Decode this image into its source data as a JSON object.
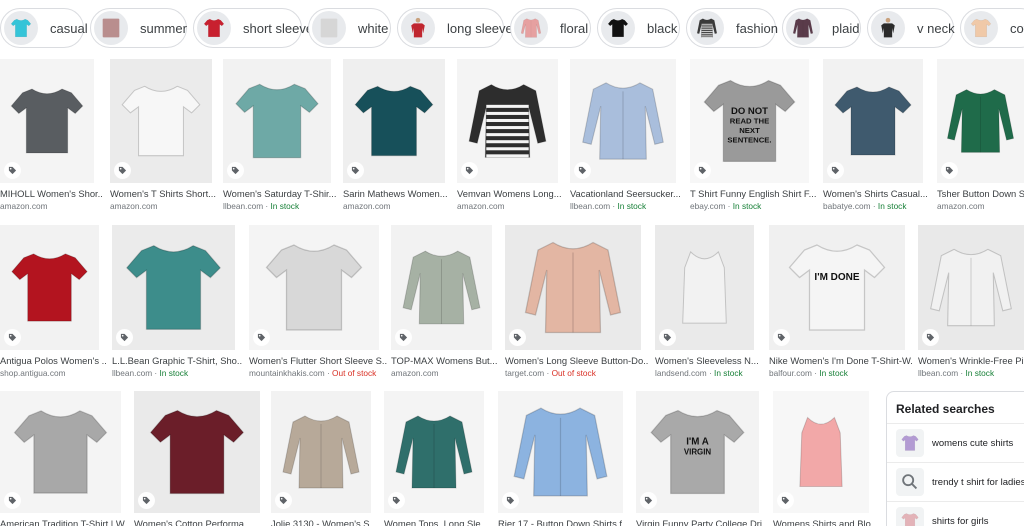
{
  "chips": [
    {
      "label": "casual",
      "color": "#35c4d8",
      "style": "tee"
    },
    {
      "label": "summer",
      "color": "#b98e8e",
      "style": "photo"
    },
    {
      "label": "short sleeve",
      "color": "#c8202f",
      "style": "tee"
    },
    {
      "label": "white",
      "color": "#d6d6d6",
      "style": "photo"
    },
    {
      "label": "long sleeve",
      "color": "#c0262f",
      "style": "person"
    },
    {
      "label": "floral",
      "color": "#e6a0a0",
      "style": "long"
    },
    {
      "label": "black",
      "color": "#111111",
      "style": "tee"
    },
    {
      "label": "fashion",
      "color": "#3a3a3a",
      "style": "stripe"
    },
    {
      "label": "plaid",
      "color": "#5a3b4a",
      "style": "long"
    },
    {
      "label": "v neck",
      "color": "#2b2b2b",
      "style": "person"
    },
    {
      "label": "cotto",
      "color": "#f0c9a8",
      "style": "tee"
    }
  ],
  "results": [
    [
      {
        "title": "MIHOLL Women's Shor...",
        "source": "amazon.com",
        "stock": "",
        "color": "#595d61",
        "bg": "#f4f4f4",
        "style": "tee"
      },
      {
        "title": "Women's T Shirts Short...",
        "source": "amazon.com",
        "stock": "",
        "color": "#f7f7f7",
        "bg": "#ebebeb",
        "style": "tee"
      },
      {
        "title": "Women's Saturday T-Shir...",
        "source": "llbean.com",
        "stock": "In stock",
        "color": "#6ea9a6",
        "bg": "#f2f2f2",
        "style": "tee"
      },
      {
        "title": "Sarin Mathews Women...",
        "source": "amazon.com",
        "stock": "",
        "color": "#17505a",
        "bg": "#efefef",
        "style": "tee"
      },
      {
        "title": "Vemvan Womens Long...",
        "source": "amazon.com",
        "stock": "",
        "color": "#2d2d2d",
        "bg": "#f4f4f4",
        "style": "stripe"
      },
      {
        "title": "Vacationland Seersucker...",
        "source": "llbean.com",
        "stock": "In stock",
        "color": "#a9bedc",
        "bg": "#f4f4f4",
        "style": "long"
      },
      {
        "title": "T Shirt Funny English Shirt F...",
        "source": "ebay.com",
        "stock": "In stock",
        "color": "#9a9a9a",
        "bg": "#f7f7f7",
        "style": "print",
        "print": "DO NOT READ THE NEXT SENTENCE."
      },
      {
        "title": "Women's Shirts Casual...",
        "source": "babatye.com",
        "stock": "In stock",
        "color": "#3f5a6e",
        "bg": "#f2f2f2",
        "style": "tee"
      },
      {
        "title": "Tsher Button Down Shi...",
        "source": "amazon.com",
        "stock": "",
        "color": "#1f6b4a",
        "bg": "#f4f4f4",
        "style": "long"
      }
    ],
    [
      {
        "title": "Antigua Polos Women's ...",
        "source": "shop.antigua.com",
        "stock": "",
        "color": "#b3141f",
        "bg": "#f2f2f2",
        "style": "tee"
      },
      {
        "title": "L.L.Bean Graphic T-Shirt, Sho...",
        "source": "llbean.com",
        "stock": "In stock",
        "color": "#3d8d8b",
        "bg": "#ebebeb",
        "style": "tee"
      },
      {
        "title": "Women's Flutter Short Sleeve S...",
        "source": "mountainkhakis.com",
        "stock": "Out of stock",
        "color": "#d8d8d8",
        "bg": "#f4f4f4",
        "style": "tee"
      },
      {
        "title": "TOP-MAX Womens But...",
        "source": "amazon.com",
        "stock": "",
        "color": "#a6b1a4",
        "bg": "#f2f2f2",
        "style": "long"
      },
      {
        "title": "Women's Long Sleeve Button-Do...",
        "source": "target.com",
        "stock": "Out of stock",
        "color": "#e3b6a3",
        "bg": "#eaeaea",
        "style": "long"
      },
      {
        "title": "Women's Sleeveless N...",
        "source": "landsend.com",
        "stock": "In stock",
        "color": "#f2f2f2",
        "bg": "#eaeaea",
        "style": "tank"
      },
      {
        "title": "Nike Women's I'm Done T-Shirt-W...",
        "source": "balfour.com",
        "stock": "In stock",
        "color": "#f5f5f5",
        "bg": "#f0f0f0",
        "style": "print",
        "print": "I'M DONE"
      },
      {
        "title": "Women's Wrinkle-Free Pinpoi...",
        "source": "llbean.com",
        "stock": "In stock",
        "color": "#f1f1f1",
        "bg": "#e9e9e9",
        "style": "long"
      }
    ],
    [
      {
        "title": "American Tradition T-Shirt | W...",
        "source": "",
        "stock": "",
        "color": "#a8a8a8",
        "bg": "#f4f4f4",
        "style": "tee"
      },
      {
        "title": "Women's Cotton Performa...",
        "source": "",
        "stock": "",
        "color": "#6b1e29",
        "bg": "#eaeaea",
        "style": "tee"
      },
      {
        "title": "Jolie 3130 - Women's S...",
        "source": "",
        "stock": "",
        "color": "#b7a999",
        "bg": "#f2f2f2",
        "style": "long"
      },
      {
        "title": "Women Tops, Long Sle...",
        "source": "",
        "stock": "",
        "color": "#2f6f6b",
        "bg": "#f4f4f4",
        "style": "long"
      },
      {
        "title": "Rjer 17 - Button Down Shirts f...",
        "source": "",
        "stock": "",
        "color": "#8cb3e0",
        "bg": "#f4f4f4",
        "style": "long"
      },
      {
        "title": "Virgin Funny Party College Dri...",
        "source": "",
        "stock": "",
        "color": "#a9a9a9",
        "bg": "#f3f3f3",
        "style": "print",
        "print": "I'M A VIRGIN"
      },
      {
        "title": "Womens Shirts and Blo...",
        "source": "",
        "stock": "",
        "color": "#f2a8a8",
        "bg": "#f7f7f7",
        "style": "tank"
      }
    ]
  ],
  "related": {
    "title": "Related searches",
    "items": [
      {
        "label": "womens cute shirts",
        "color": "#b39bd3"
      },
      {
        "label": "trendy t shirt for ladies",
        "color": "#9aa0a6"
      },
      {
        "label": "shirts for girls",
        "color": "#e3b3b8"
      }
    ]
  }
}
